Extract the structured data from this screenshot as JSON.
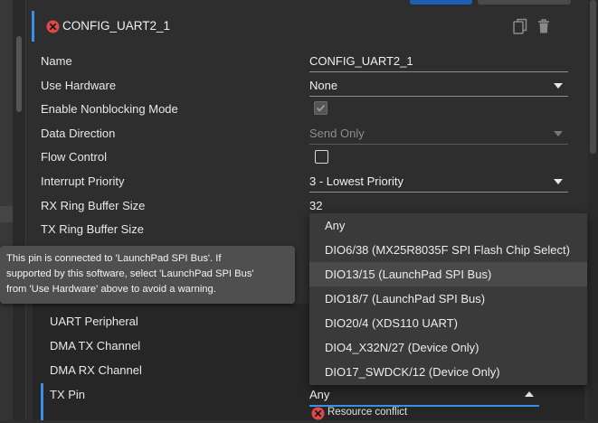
{
  "header": {
    "title": "CONFIG_UART2_1"
  },
  "fields": [
    {
      "label": "Name",
      "value": "CONFIG_UART2_1"
    },
    {
      "label": "Use Hardware",
      "value": "None"
    },
    {
      "label": "Enable Nonblocking Mode"
    },
    {
      "label": "Data Direction",
      "value": "Send Only"
    },
    {
      "label": "Flow Control"
    },
    {
      "label": "Interrupt Priority",
      "value": "3 - Lowest Priority"
    },
    {
      "label": "RX Ring Buffer Size",
      "value": "32"
    },
    {
      "label": "TX Ring Buffer Size"
    }
  ],
  "tooltip": {
    "lines": [
      "This pin is connected to 'LaunchPad SPI Bus'. If",
      "supported by this software, select 'LaunchPad SPI Bus'",
      "from 'Use Hardware' above to avoid a warning."
    ]
  },
  "pins": [
    {
      "label": "UART Peripheral"
    },
    {
      "label": "DMA TX Channel"
    },
    {
      "label": "DMA RX Channel"
    },
    {
      "label": "TX Pin",
      "value": "Any"
    }
  ],
  "dropdown": {
    "options": [
      "Any",
      "DIO6/38 (MX25R8035F SPI Flash Chip Select)",
      "DIO13/15 (LaunchPad SPI Bus)",
      "DIO18/7 (LaunchPad SPI Bus)",
      "DIO20/4 (XDS110 UART)",
      "DIO4_X32N/27 (Device Only)",
      "DIO17_SWDCK/12 (Device Only)"
    ],
    "highlighted": "DIO13/15 (LaunchPad SPI Bus)"
  },
  "status": {
    "conflict": "Resource conflict"
  },
  "colors": {
    "accent": "#3b8ee6",
    "error": "#e04848",
    "primary_button": "#1f5fb3"
  },
  "checkboxes": {
    "nonblocking": true,
    "flow_control": false
  }
}
